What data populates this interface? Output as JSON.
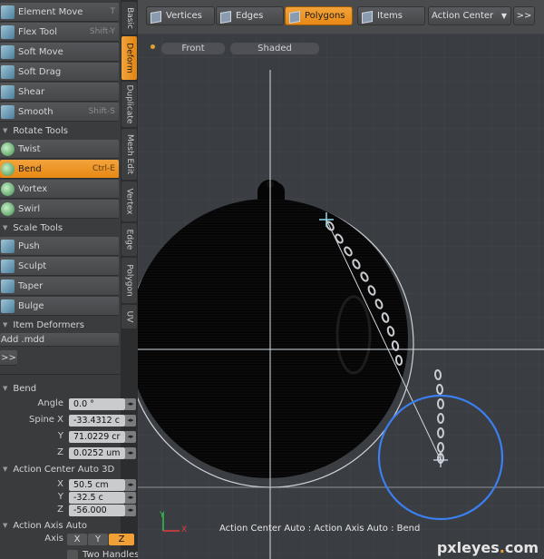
{
  "topbar": {
    "vertices": "Vertices",
    "edges": "Edges",
    "polygons": "Polygons",
    "items": "Items",
    "action_center": "Action Center",
    "expand": ">>"
  },
  "tools": {
    "element_move": {
      "label": "Element Move",
      "shortcut": "T"
    },
    "flex_tool": {
      "label": "Flex Tool",
      "shortcut": "Shift-Y"
    },
    "soft_move": {
      "label": "Soft Move"
    },
    "soft_drag": {
      "label": "Soft Drag"
    },
    "shear": {
      "label": "Shear"
    },
    "smooth": {
      "label": "Smooth",
      "shortcut": "Shift-S"
    },
    "rotate_header": "Rotate Tools",
    "twist": {
      "label": "Twist"
    },
    "bend": {
      "label": "Bend",
      "shortcut": "Ctrl-E"
    },
    "vortex": {
      "label": "Vortex"
    },
    "swirl": {
      "label": "Swirl"
    },
    "scale_header": "Scale Tools",
    "push": {
      "label": "Push"
    },
    "sculpt": {
      "label": "Sculpt"
    },
    "taper": {
      "label": "Taper"
    },
    "bulge": {
      "label": "Bulge"
    },
    "deformers_header": "Item Deformers",
    "add_mdd": "Add .mdd",
    "more": ">>"
  },
  "vtabs": [
    "Basic",
    "Deform",
    "Duplicate",
    "Mesh Edit",
    "Vertex",
    "Edge",
    "Polygon",
    "UV"
  ],
  "props": {
    "bend_header": "Bend",
    "angle_label": "Angle",
    "angle": "0.0 °",
    "spine_x_label": "Spine X",
    "spine_x": "-33.4312 c",
    "y_label": "Y",
    "spine_y": "71.0229 cr",
    "z_label": "Z",
    "spine_z": "0.0252 um",
    "ac_header": "Action Center Auto 3D",
    "x_label": "X",
    "ac_x": "50.5 cm",
    "ac_y": "-32.5 c",
    "ac_z": "-56.000",
    "aa_header": "Action Axis Auto",
    "axis_label": "Axis",
    "ax_x": "X",
    "ax_y": "Y",
    "ax_z": "Z",
    "two_handles": "Two Handles"
  },
  "viewport": {
    "front": "Front",
    "shaded": "Shaded",
    "status": "Action Center Auto : Action Axis Auto : Bend",
    "axis_y": "Y",
    "axis_x": "X"
  },
  "watermark": {
    "name": "pxleyes",
    ".com": ".com",
    "dot": "."
  }
}
